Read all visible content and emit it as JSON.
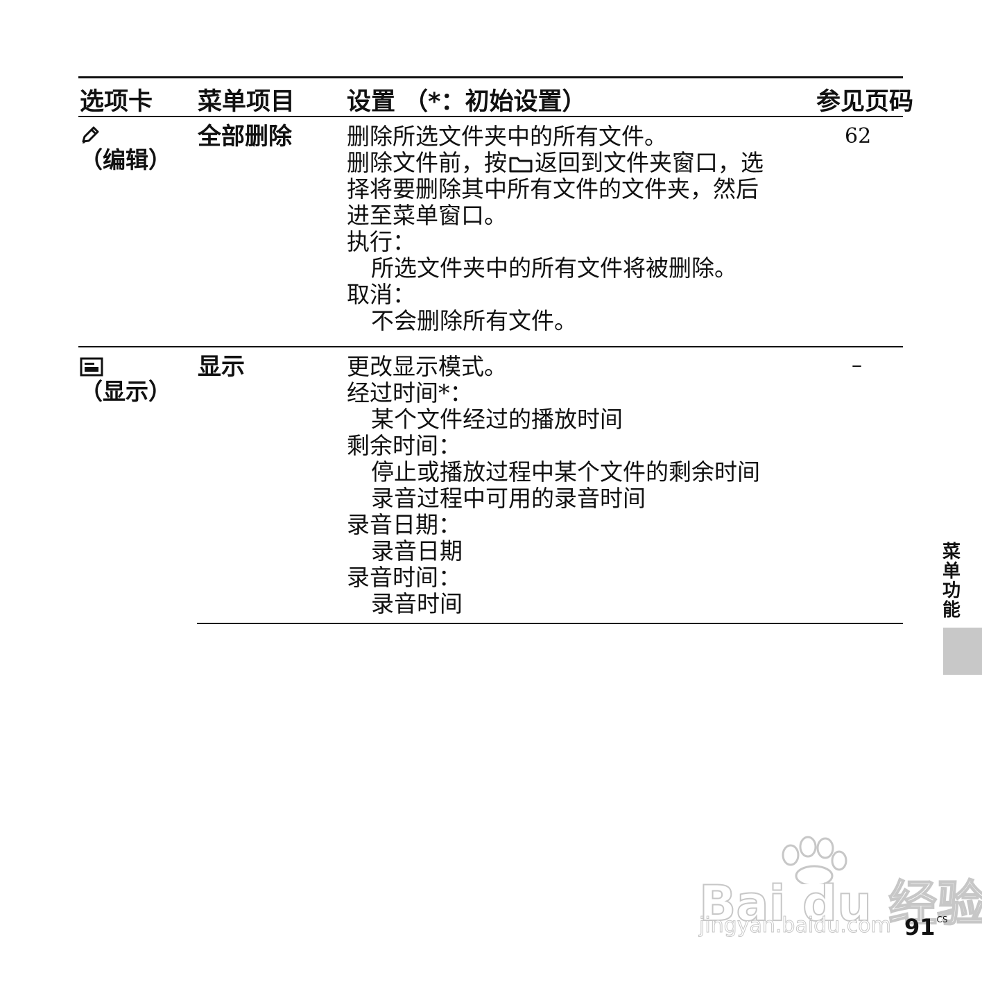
{
  "table": {
    "headers": {
      "tab": "选项卡",
      "item": "菜单项目",
      "setting": "设置 （*：初始设置）",
      "page": "参见页码"
    },
    "rows": [
      {
        "tab_icon": "pencil-icon",
        "tab_label": "（编辑）",
        "item": "全部删除",
        "lines": {
          "l1": "删除所选文件夹中的所有文件。",
          "l2a": "删除文件前，按",
          "l2_icon": "folder-icon",
          "l2b": "返回到文件夹窗口，选",
          "l3": "择将要删除其中所有文件的文件夹，然后",
          "l4": "进至菜单窗口。",
          "l5": "执行：",
          "l6": "所选文件夹中的所有文件将被删除。",
          "l7": "取消：",
          "l8": "不会删除所有文件。"
        },
        "page": "62"
      },
      {
        "tab_icon": "display-icon",
        "tab_label": "（显示）",
        "item": "显示",
        "lines": {
          "l1": "更改显示模式。",
          "l2": "经过时间*：",
          "l3": "某个文件经过的播放时间",
          "l4": "剩余时间：",
          "l5": "停止或播放过程中某个文件的剩余时间",
          "l6": "录音过程中可用的录音时间",
          "l7": "录音日期：",
          "l8": "录音日期",
          "l9": "录音时间：",
          "l10": "录音时间"
        },
        "page": "–"
      }
    ]
  },
  "side_tab_label": "菜单功能",
  "watermark": {
    "brand": "Bai du 经验",
    "url": "jingyan.baidu.com"
  },
  "page_number": "91",
  "page_suffix": "CS"
}
